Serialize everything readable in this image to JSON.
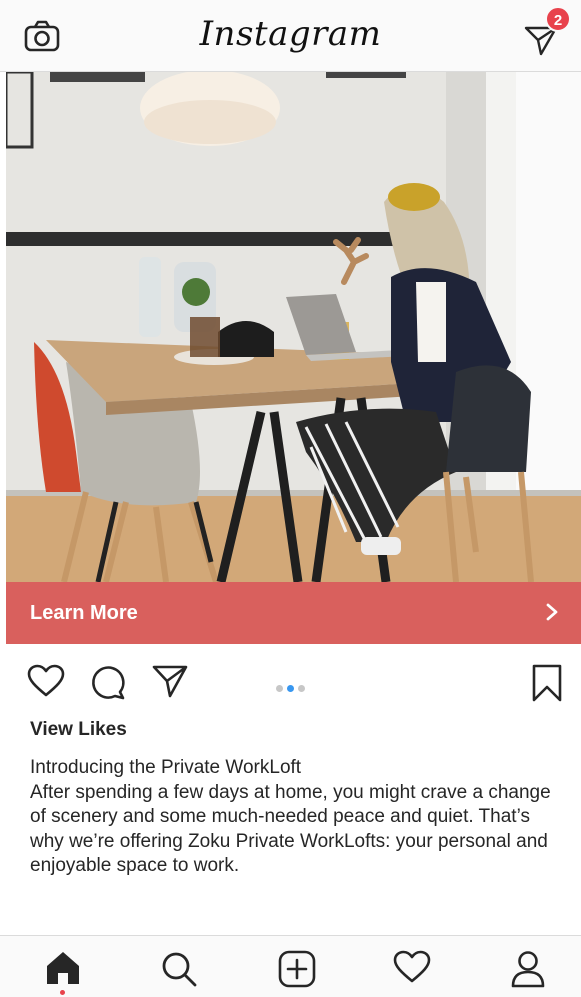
{
  "app": {
    "title": "Instagram"
  },
  "header": {
    "camera_icon": "camera-icon",
    "direct_icon": "paper-plane-icon",
    "notification_count": "2",
    "badge_color": "#e8424c"
  },
  "post": {
    "cta_label": "Learn More",
    "cta_color": "#d9605d",
    "carousel": {
      "count": 3,
      "active_index": 1
    },
    "likes_label": "View Likes",
    "caption_title": "Introducing the Private WorkLoft",
    "caption_body": "After spending a few days at home, you might crave a change of scenery and some much-needed peace and quiet. That’s why we’re offering Zoku Private WorkLofts: your personal and enjoyable space to work."
  },
  "actions": {
    "like_icon": "heart-icon",
    "comment_icon": "comment-icon",
    "share_icon": "paper-plane-icon",
    "save_icon": "bookmark-icon"
  },
  "bottom_nav": {
    "items": [
      "home-icon",
      "search-icon",
      "add-post-icon",
      "activity-heart-icon",
      "profile-icon"
    ],
    "active": "home-icon"
  }
}
